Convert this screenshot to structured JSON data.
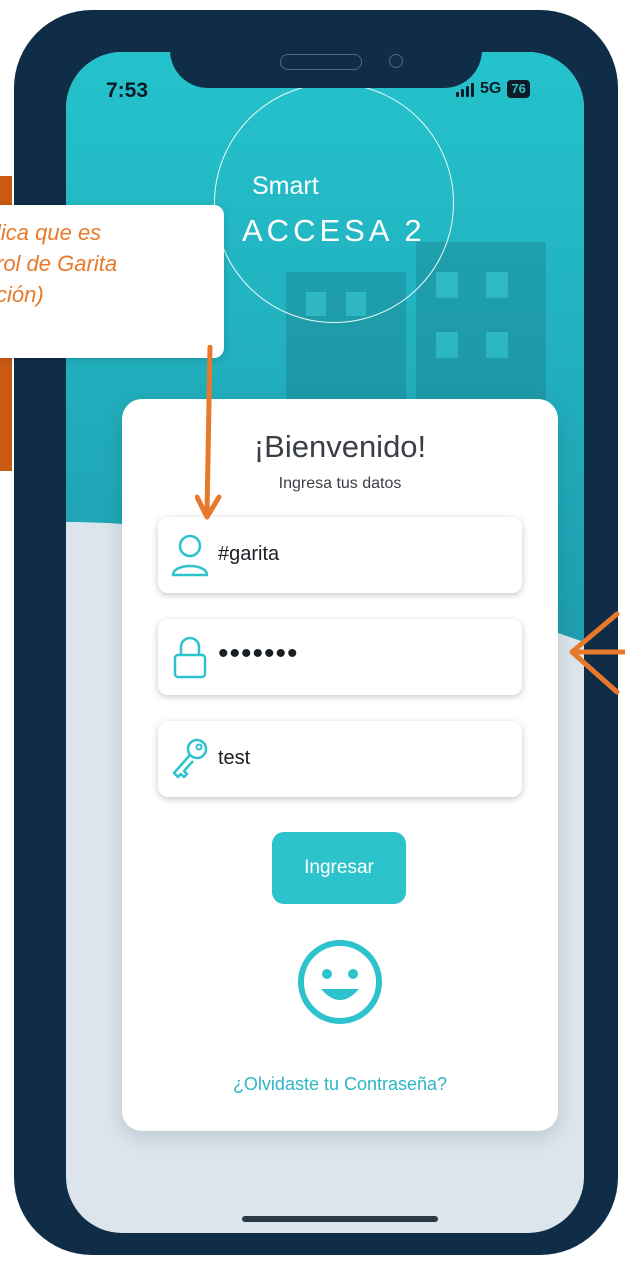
{
  "status_bar": {
    "time": "7:53",
    "network": "5G",
    "battery": "76"
  },
  "logo": {
    "line1": "Smart",
    "line2": "ACCESA 2"
  },
  "login": {
    "title": "¡Bienvenido!",
    "subtitle": "Ingresa tus datos",
    "user_value": "#garita",
    "password_mask": "•••••••",
    "code_value": "test",
    "submit_label": "Ingresar",
    "forgot_link": "¿Olvidaste tu Contraseña?"
  },
  "annotation": {
    "callout_text": "lica que es\nrol de Garita\nción)"
  },
  "icons": {
    "user": "user-icon",
    "lock": "lock-icon",
    "key": "key-icon",
    "face": "smiley-face-icon"
  },
  "colors": {
    "accent": "#2cc3cd",
    "frame": "#0f2d47",
    "annotation": "#e8792a",
    "link": "#2bb6c5"
  }
}
